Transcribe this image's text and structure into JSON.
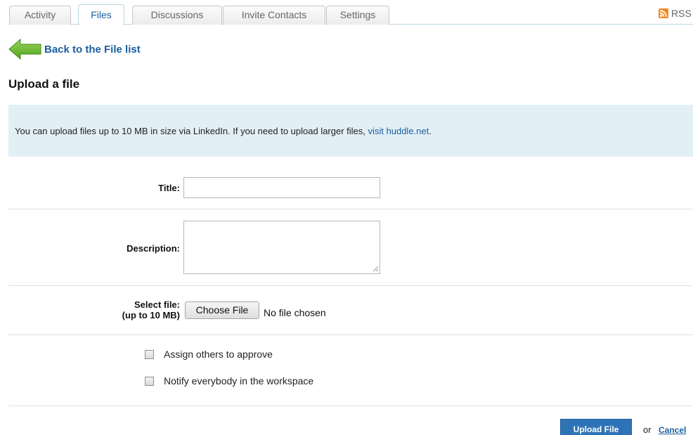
{
  "tabs": [
    {
      "label": "Activity",
      "active": false
    },
    {
      "label": "Files",
      "active": true
    },
    {
      "label": "Discussions",
      "active": false
    },
    {
      "label": "Invite Contacts",
      "active": false
    },
    {
      "label": "Settings",
      "active": false
    }
  ],
  "rss": {
    "label": "RSS",
    "icon": "rss-icon"
  },
  "back_link": {
    "label": "Back to the File list",
    "icon": "back-arrow-icon"
  },
  "page_title": "Upload a file",
  "info": {
    "text": "You can upload files up to 10 MB in size via LinkedIn. If you need to upload larger files, ",
    "link_text": "visit huddle.net",
    "suffix": "."
  },
  "form": {
    "title_label": "Title:",
    "title_value": "",
    "description_label": "Description:",
    "description_value": "",
    "file_label_line1": "Select file:",
    "file_label_line2": "(up to 10 MB)",
    "choose_file_label": "Choose File",
    "file_status": "No file chosen",
    "options": [
      {
        "label": "Assign others to approve",
        "checked": false
      },
      {
        "label": "Notify everybody in the workspace",
        "checked": false
      }
    ]
  },
  "footer": {
    "upload_label": "Upload File",
    "or_text": "or",
    "cancel_label": "Cancel"
  },
  "colors": {
    "accent": "#1a5fa0",
    "info_bg": "#e2f0f6",
    "button_bg": "#2f73b7",
    "arrow_green": "#6cbf2a"
  }
}
